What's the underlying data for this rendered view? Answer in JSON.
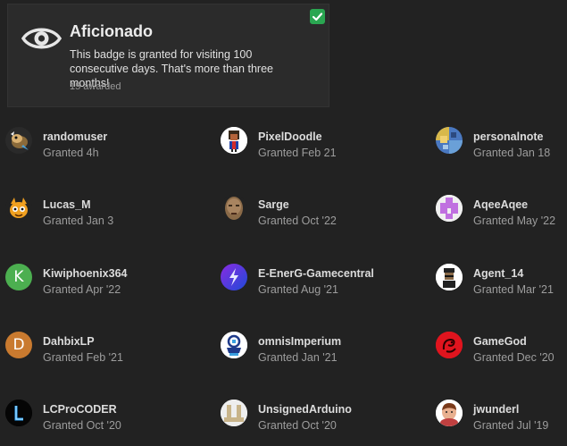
{
  "badge": {
    "title": "Aficionado",
    "description": "This badge is granted for visiting 100 consecutive days. That's more than three months!",
    "awarded": "15 awarded",
    "icon": "eye-icon",
    "check_icon": "check-icon",
    "check_color": "#2aa651"
  },
  "users": [
    {
      "name": "randomuser",
      "granted": "Granted 4h"
    },
    {
      "name": "PixelDoodle",
      "granted": "Granted Feb 21"
    },
    {
      "name": "personalnote",
      "granted": "Granted Jan 18"
    },
    {
      "name": "Lucas_M",
      "granted": "Granted Jan 3"
    },
    {
      "name": "Sarge",
      "granted": "Granted Oct '22"
    },
    {
      "name": "AqeeAqee",
      "granted": "Granted May '22"
    },
    {
      "name": "Kiwiphoenix364",
      "granted": "Granted Apr '22",
      "initial": "K",
      "color": "#4caf50"
    },
    {
      "name": "E-EnerG-Gamecentral",
      "granted": "Granted Aug '21"
    },
    {
      "name": "Agent_14",
      "granted": "Granted Mar '21"
    },
    {
      "name": "DahbixLP",
      "granted": "Granted Feb '21",
      "initial": "D",
      "color": "#c97a2f"
    },
    {
      "name": "omnisImperium",
      "granted": "Granted Jan '21"
    },
    {
      "name": "GameGod",
      "granted": "Granted Dec '20"
    },
    {
      "name": "LCProCODER",
      "granted": "Granted Oct '20"
    },
    {
      "name": "UnsignedArduino",
      "granted": "Granted Oct '20"
    },
    {
      "name": "jwunderl",
      "granted": "Granted Jul '19"
    }
  ]
}
